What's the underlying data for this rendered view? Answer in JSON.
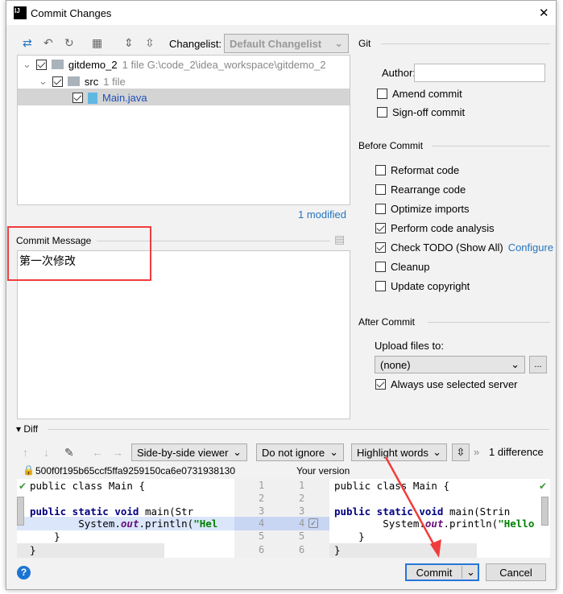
{
  "window": {
    "title": "Commit Changes",
    "close": "✕",
    "app_icon": "IJ"
  },
  "toolbar": {
    "changelist_label": "Changelist:",
    "changelist_value": "Default Changelist"
  },
  "tree": [
    {
      "name": "gitdemo_2",
      "meta": "1 file  G:\\code_2\\idea_workspace\\gitdemo_2"
    },
    {
      "name": "src",
      "meta": "1 file"
    },
    {
      "name": "Main.java",
      "meta": ""
    }
  ],
  "modified": "1 modified",
  "commit_message": {
    "label": "Commit Message",
    "value": "第一次修改"
  },
  "git": {
    "title": "Git",
    "author_label": "Author:",
    "author_value": "",
    "amend": "Amend commit",
    "signoff": "Sign-off commit"
  },
  "before_commit": {
    "title": "Before Commit",
    "items": [
      {
        "label": "Reformat code",
        "checked": false
      },
      {
        "label": "Rearrange code",
        "checked": false
      },
      {
        "label": "Optimize imports",
        "checked": false
      },
      {
        "label": "Perform code analysis",
        "checked": true
      },
      {
        "label": "Check TODO (Show All)",
        "checked": true
      },
      {
        "label": "Cleanup",
        "checked": false
      },
      {
        "label": "Update copyright",
        "checked": false
      }
    ],
    "configure": "Configure"
  },
  "after_commit": {
    "title": "After Commit",
    "upload_label": "Upload files to:",
    "upload_value": "(none)",
    "more": "...",
    "always": "Always use selected server"
  },
  "diff": {
    "title": "Diff",
    "viewer": "Side-by-side viewer",
    "ignore": "Do not ignore",
    "highlight": "Highlight words",
    "count": "1 difference",
    "left_rev": "500f0f195b65ccf5ffa9259150ca6e0731938130",
    "right_rev": "Your version",
    "left_lines": [
      "public class Main {",
      "",
      "    public static void main(Str",
      "        System.out.println(\"Hel",
      "    }",
      "}"
    ],
    "right_lines": [
      "public class Main {",
      "",
      "    public static void main(Strin",
      "        System.out.println(\"Hello",
      "    }",
      "}"
    ],
    "line_numbers": [
      "1",
      "2",
      "3",
      "4",
      "5",
      "6"
    ]
  },
  "buttons": {
    "commit": "Commit",
    "cancel": "Cancel",
    "help": "?"
  },
  "colors": {
    "accent": "#2675bf",
    "annotation": "#f03c3c",
    "diff_highlight": "#dbe6fb"
  }
}
